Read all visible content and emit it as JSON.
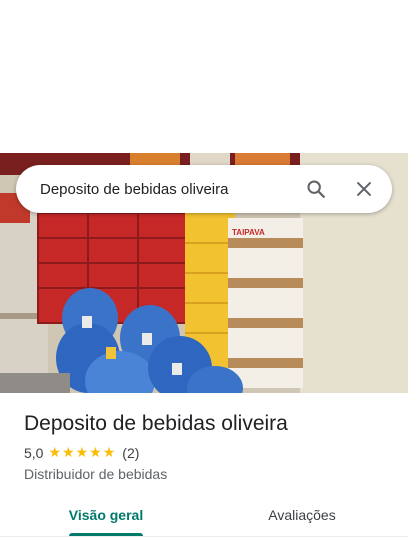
{
  "search": {
    "value": "Deposito de bebidas oliveira",
    "search_icon": "search-icon",
    "close_icon": "close-icon"
  },
  "photo": {
    "description_icon": "place-photo",
    "brand_text": "TAIPAVA"
  },
  "place": {
    "title": "Deposito de bebidas oliveira",
    "rating": "5,0",
    "stars": 5,
    "review_count": "(2)",
    "category": "Distribuidor de bebidas"
  },
  "tabs": [
    {
      "label": "Visão geral",
      "active": true
    },
    {
      "label": "Avaliações",
      "active": false
    }
  ],
  "colors": {
    "accent": "#00796b",
    "star": "#fbbc04",
    "text_primary": "#202124",
    "text_secondary": "#5f6368"
  }
}
